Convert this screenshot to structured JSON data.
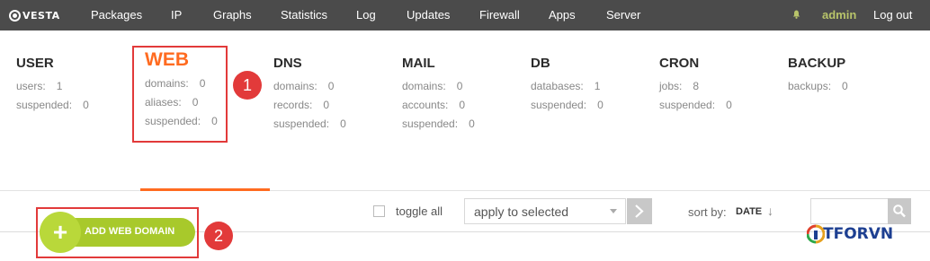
{
  "topbar": {
    "logo_text": "VESTA",
    "nav": [
      "Packages",
      "IP",
      "Graphs",
      "Statistics",
      "Log",
      "Updates",
      "Firewall",
      "Apps",
      "Server"
    ],
    "user": "admin",
    "logout": "Log out",
    "bell_icon": "bell-icon",
    "admin_color": "#b8c46a"
  },
  "stats": {
    "user": {
      "title": "USER",
      "rows": [
        {
          "label": "users:",
          "value": "1"
        },
        {
          "label": "suspended:",
          "value": "0"
        }
      ]
    },
    "web": {
      "title": "WEB",
      "rows": [
        {
          "label": "domains:",
          "value": "0"
        },
        {
          "label": "aliases:",
          "value": "0"
        },
        {
          "label": "suspended:",
          "value": "0"
        }
      ]
    },
    "dns": {
      "title": "DNS",
      "rows": [
        {
          "label": "domains:",
          "value": "0"
        },
        {
          "label": "records:",
          "value": "0"
        },
        {
          "label": "suspended:",
          "value": "0"
        }
      ]
    },
    "mail": {
      "title": "MAIL",
      "rows": [
        {
          "label": "domains:",
          "value": "0"
        },
        {
          "label": "accounts:",
          "value": "0"
        },
        {
          "label": "suspended:",
          "value": "0"
        }
      ]
    },
    "db": {
      "title": "DB",
      "rows": [
        {
          "label": "databases:",
          "value": "1"
        },
        {
          "label": "suspended:",
          "value": "0"
        }
      ]
    },
    "cron": {
      "title": "CRON",
      "rows": [
        {
          "label": "jobs:",
          "value": "8"
        },
        {
          "label": "suspended:",
          "value": "0"
        }
      ]
    },
    "backup": {
      "title": "BACKUP",
      "rows": [
        {
          "label": "backups:",
          "value": "0"
        }
      ]
    }
  },
  "annotations": {
    "badge1": "1",
    "badge2": "2",
    "color": "#e23a3a"
  },
  "toolbar": {
    "add_label": "ADD WEB DOMAIN",
    "add_icon": "plus-icon",
    "toggle_all": "toggle all",
    "bulk_action": "apply to selected",
    "sort_label": "sort by:",
    "sort_value": "DATE",
    "sort_arrow": "↓",
    "search_icon": "search-icon",
    "accent": "#ff6b20",
    "button_color": "#a8c92b"
  },
  "watermark": {
    "text": "TFORVN"
  }
}
